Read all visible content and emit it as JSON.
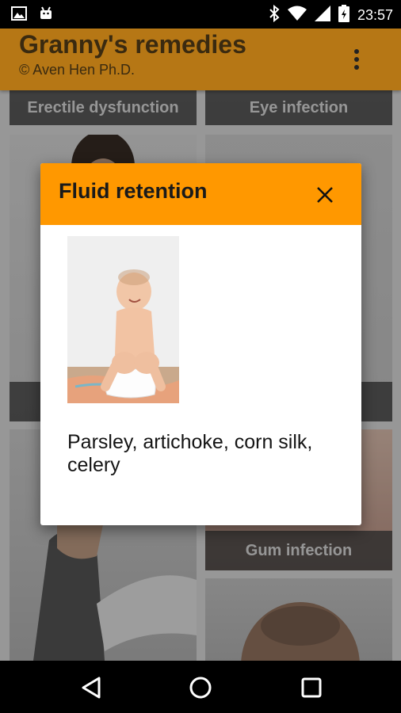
{
  "status_bar": {
    "time": "23:57",
    "icons": [
      "image-notification-icon",
      "android-notification-icon",
      "bluetooth-icon",
      "wifi-icon",
      "cell-signal-icon",
      "battery-icon"
    ]
  },
  "app_bar": {
    "title": "Granny's remedies",
    "subtitle": "© Aven Hen Ph.D.",
    "menu_icon": "overflow-menu-icon",
    "color": "#b67715"
  },
  "grid": {
    "tiles": [
      {
        "label": "Erectile dysfunction"
      },
      {
        "label": "Eye infection"
      },
      {
        "label": "Gum infection"
      }
    ]
  },
  "dialog": {
    "title": "Fluid retention",
    "close_icon": "close-icon",
    "header_color": "#ff9800",
    "image_alt": "baby-on-potty-image",
    "text": "Parsley, artichoke, corn silk, celery"
  },
  "nav_bar": {
    "buttons": [
      "back-icon",
      "home-icon",
      "recents-icon"
    ]
  }
}
